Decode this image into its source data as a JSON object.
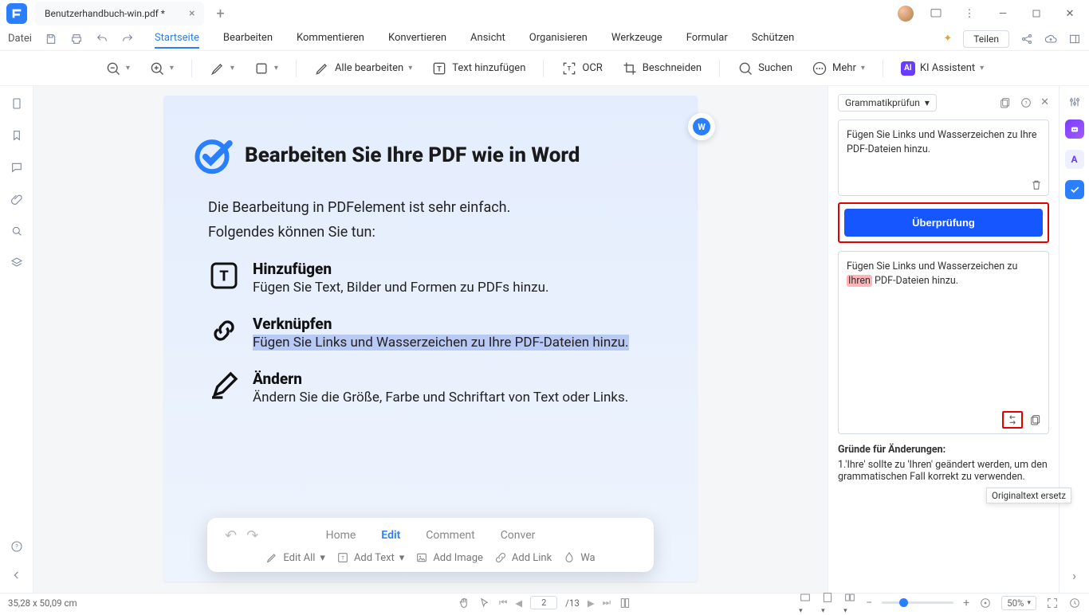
{
  "titlebar": {
    "tab_title": "Benutzerhandbuch-win.pdf *"
  },
  "menu": {
    "file": "Datei",
    "tabs": [
      "Startseite",
      "Bearbeiten",
      "Kommentieren",
      "Konvertieren",
      "Ansicht",
      "Organisieren",
      "Werkzeuge",
      "Formular",
      "Schützen"
    ],
    "active_index": 0,
    "share": "Teilen"
  },
  "toolbar": {
    "edit_all": "Alle bearbeiten",
    "add_text": "Text hinzufügen",
    "ocr": "OCR",
    "crop": "Beschneiden",
    "search": "Suchen",
    "more": "Mehr",
    "ai": "KI Assistent"
  },
  "page": {
    "h1": "Bearbeiten Sie Ihre PDF wie in Word",
    "intro1": "Die Bearbeitung in PDFelement ist sehr einfach.",
    "intro2": "Folgendes können Sie tun:",
    "feat1_t": "Hinzufügen",
    "feat1_d": "Fügen Sie Text, Bilder und Formen zu PDFs hinzu.",
    "feat2_t": "Verknüpfen",
    "feat2_d": "Fügen Sie Links und Wasserzeichen zu Ihre PDF-Dateien hinzu.",
    "feat3_t": "Ändern",
    "feat3_d": "Ändern Sie die Größe, Farbe und Schriftart von Text oder Links."
  },
  "float": {
    "tab_home": "Home",
    "tab_edit": "Edit",
    "tab_comment": "Comment",
    "tab_convert": "Conver",
    "edit_all": "Edit All",
    "add_text": "Add Text",
    "add_image": "Add Image",
    "add_link": "Add Link",
    "wa": "Wa"
  },
  "ai": {
    "mode": "Grammatikprüfun",
    "input": "Fügen Sie Links und Wasserzeichen zu Ihre PDF-Dateien hinzu.",
    "check_btn": "Überprüfung",
    "result_pre": "Fügen Sie Links und Wasserzeichen zu ",
    "result_hl": "Ihren",
    "result_post": " PDF-Dateien hinzu.",
    "reasons_title": "Gründe für Änderungen:",
    "reason1": "1.'Ihre' sollte zu 'Ihren' geändert werden, um den grammatischen Fall korrekt zu verwenden.",
    "tooltip": "Originaltext ersetz"
  },
  "status": {
    "coords": "35,28 x 50,09 cm",
    "page_current": "2",
    "page_total": "/13",
    "zoom": "50%"
  }
}
